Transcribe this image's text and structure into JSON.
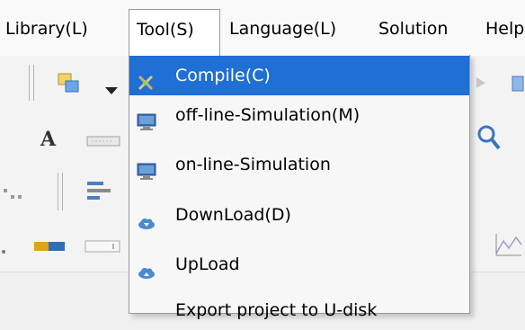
{
  "menubar": {
    "items": [
      {
        "label": "Library(L)"
      },
      {
        "label": "Tool(S)"
      },
      {
        "label": "Language(L)"
      },
      {
        "label": "Solution"
      },
      {
        "label": "Help"
      }
    ]
  },
  "toolbar": {
    "text_tool_glyph": "A"
  },
  "dropdown": {
    "items": [
      {
        "label": "Compile(C)",
        "icon": "compile-icon"
      },
      {
        "label": "off-line-Simulation(M)",
        "icon": "monitor-icon"
      },
      {
        "label": "on-line-Simulation",
        "icon": "monitor-icon"
      },
      {
        "label": "DownLoad(D)",
        "icon": "cloud-download-icon"
      },
      {
        "label": "UpLoad",
        "icon": "cloud-upload-icon"
      },
      {
        "label": "Export project to U-disk",
        "icon": ""
      }
    ]
  },
  "colors": {
    "selection": "#1f6fd4",
    "menu_background": "#f7f7f7"
  }
}
